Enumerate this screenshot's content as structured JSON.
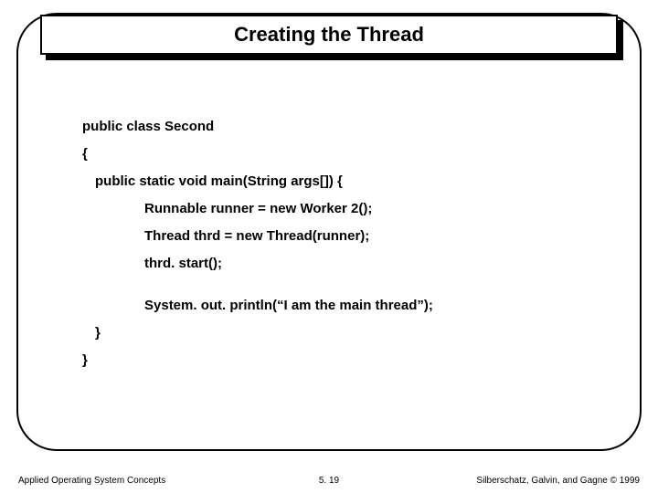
{
  "title": "Creating the Thread",
  "code": {
    "l1": "public class Second",
    "l2": "{",
    "l3": "public static void main(String args[]) {",
    "l4": "Runnable runner = new Worker 2();",
    "l5": "Thread thrd = new Thread(runner);",
    "l6": "thrd. start();",
    "l7": "System. out. println(“I am the main thread”);",
    "l8": "}",
    "l9": "}"
  },
  "footer": {
    "left": "Applied Operating System Concepts",
    "center": "5. 19",
    "right": "Silberschatz, Galvin, and Gagne © 1999"
  }
}
